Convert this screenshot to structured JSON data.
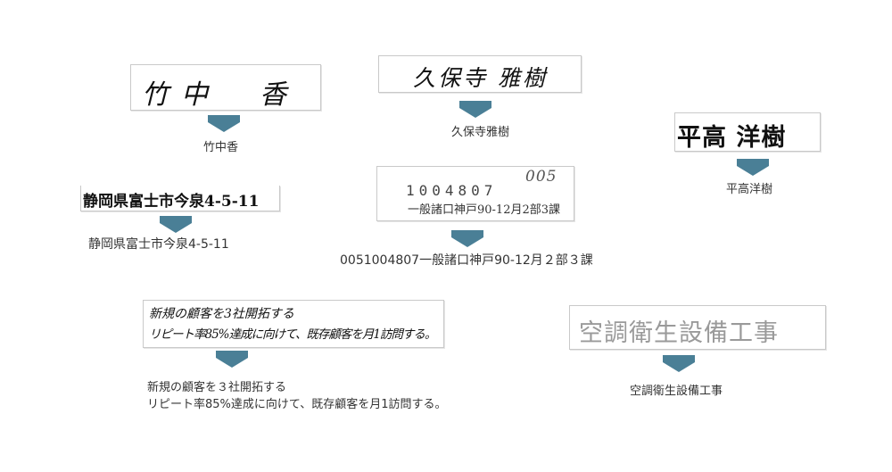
{
  "samples": [
    {
      "handwriting": "竹中　香",
      "result": "竹中香"
    },
    {
      "handwriting": "久保寺 雅樹",
      "result": "久保寺雅樹"
    },
    {
      "handwriting": "平高 洋樹",
      "result": "平高洋樹"
    },
    {
      "handwriting": "静岡県富士市今泉4-5-11",
      "result": "静岡県富士市今泉4-5-11"
    },
    {
      "typed_number": "1004807",
      "typed_text": "一般諸口神戸90-12月2部3課",
      "handwritten_code": "005",
      "result": "0051004807一般諸口神戸90-12月２部３課"
    },
    {
      "handwriting_line1": "新規の顧客を3社開拓する",
      "handwriting_line2": "リピート率85%達成に向けて、既存顧客を月1訪問する。",
      "result_line1": "新規の顧客を３社開拓する",
      "result_line2": "リピート率85%達成に向けて、既存顧客を月1訪問する。"
    },
    {
      "handwriting": "空調衛生設備工事",
      "result": "空調衛生設備工事"
    }
  ]
}
